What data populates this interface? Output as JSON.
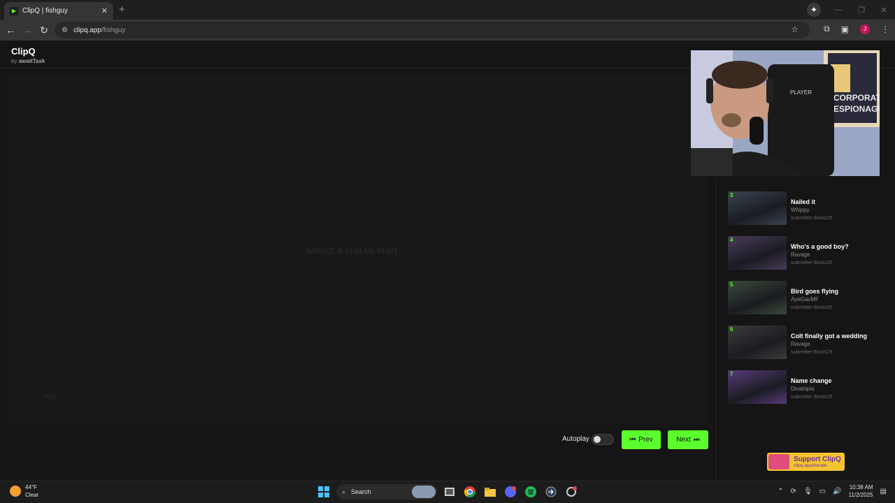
{
  "browser": {
    "tab_title": "ClipQ | fishguy",
    "url_host": "clipq.app",
    "url_path": "/fishguy",
    "profile_initial": "J"
  },
  "app": {
    "brand": "ClipQ",
    "byline_prefix": "by",
    "byline_author": "awaitTask"
  },
  "player": {
    "placeholder": "select a clip to start",
    "time": "0:00"
  },
  "controls": {
    "autoplay_label": "Autoplay",
    "autoplay_on": false,
    "prev_label": "Prev",
    "next_label": "Next"
  },
  "queue": [
    {
      "num": "3",
      "title": "Nailed it",
      "creator": "Whippy",
      "submitter": "submitter tboris25",
      "thumb_color": "#3a4450"
    },
    {
      "num": "4",
      "title": "Who's a good boy?",
      "creator": "Ravage",
      "submitter": "submitter tboris25",
      "thumb_color": "#4a3a5a"
    },
    {
      "num": "5",
      "title": "Bird goes flying",
      "creator": "AyeGavMF",
      "submitter": "submitter tboris25",
      "thumb_color": "#3a4a3a"
    },
    {
      "num": "6",
      "title": "Colt finally got a wedding",
      "creator": "Ravage",
      "submitter": "submitter tboris25",
      "thumb_color": "#3c3c3c"
    },
    {
      "num": "7",
      "title": "Name change",
      "creator": "Divatopia",
      "submitter": "submitter tboris25",
      "thumb_color": "#5a3a7a"
    }
  ],
  "webcam": {
    "sign_line1": "CORPORATE",
    "sign_line2": "ESPIONAGE"
  },
  "support": {
    "title": "Support ClipQ",
    "url": "clipq.app/donate"
  },
  "taskbar": {
    "temp": "44°F",
    "condition": "Clear",
    "search_label": "Search",
    "time": "10:38 AM",
    "date": "11/2/2025"
  },
  "colors": {
    "accent": "#5cff2e",
    "background": "#141514"
  }
}
